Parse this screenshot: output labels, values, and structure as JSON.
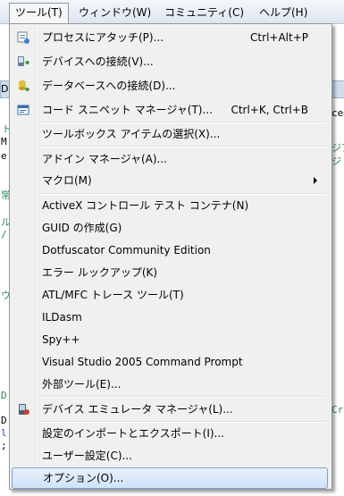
{
  "menubar": {
    "items": [
      {
        "label": "ツール(T)"
      },
      {
        "label": "ウィンドウ(W)"
      },
      {
        "label": "コミュニティ(C)"
      },
      {
        "label": "ヘルプ(H)"
      }
    ]
  },
  "background": {
    "left_code": [
      "ト",
      "M",
      "e",
      "常",
      "ル",
      "/",
      "ウ",
      "D",
      "D",
      "l:",
      ";"
    ],
    "right_code": [
      "ce",
      "ジア",
      "ジ",
      "Cre"
    ],
    "tab_left": "Di"
  },
  "menu": {
    "items": [
      {
        "label": "プロセスにアタッチ(P)...",
        "shortcut": "Ctrl+Alt+P",
        "icon": "attach-process-icon"
      },
      {
        "label": "デバイスへの接続(V)...",
        "shortcut": "",
        "icon": "device-connect-icon"
      },
      {
        "label": "データベースへの接続(D)...",
        "shortcut": "",
        "icon": "database-connect-icon"
      },
      {
        "label": "コード スニペット マネージャ(T)...",
        "shortcut": "Ctrl+K, Ctrl+B",
        "icon": "snippet-manager-icon"
      },
      {
        "label": "ツールボックス アイテムの選択(X)...",
        "shortcut": ""
      },
      {
        "label": "アドイン マネージャ(A)...",
        "shortcut": ""
      },
      {
        "label": "マクロ(M)",
        "shortcut": "",
        "submenu": true
      },
      {
        "label": "ActiveX コントロール テスト コンテナ(N)",
        "shortcut": ""
      },
      {
        "label": "GUID の作成(G)",
        "shortcut": ""
      },
      {
        "label": "Dotfuscator Community Edition",
        "shortcut": ""
      },
      {
        "label": "エラー ルックアップ(K)",
        "shortcut": ""
      },
      {
        "label": "ATL/MFC トレース ツール(T)",
        "shortcut": ""
      },
      {
        "label": "ILDasm",
        "shortcut": ""
      },
      {
        "label": "Spy++",
        "shortcut": ""
      },
      {
        "label": "Visual Studio 2005 Command Prompt",
        "shortcut": ""
      },
      {
        "label": "外部ツール(E)...",
        "shortcut": ""
      },
      {
        "label": "デバイス エミュレータ マネージャ(L)...",
        "shortcut": "",
        "icon": "emulator-manager-icon"
      },
      {
        "label": "設定のインポートとエクスポート(I)...",
        "shortcut": ""
      },
      {
        "label": "ユーザー設定(C)...",
        "shortcut": ""
      },
      {
        "label": "オプション(O)...",
        "shortcut": ""
      }
    ]
  }
}
